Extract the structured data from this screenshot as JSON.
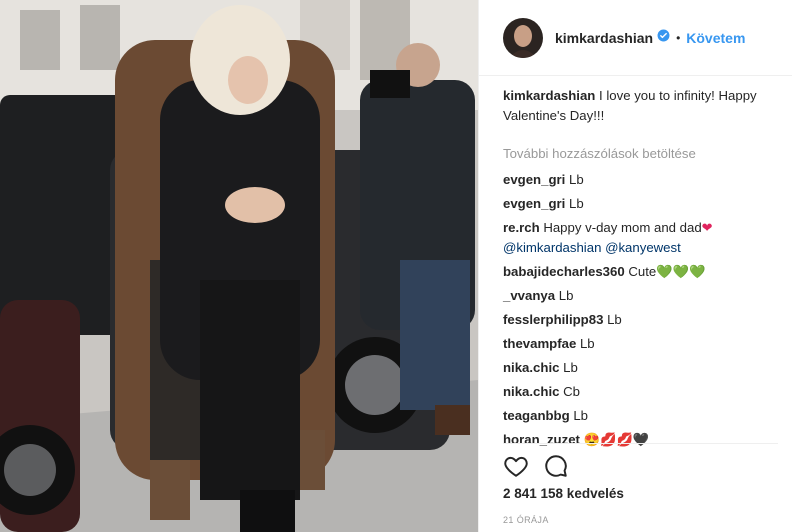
{
  "post": {
    "username": "kimkardashian",
    "follow_label": "Követem",
    "dot": "•",
    "caption_user": "kimkardashian",
    "caption_text": "I love you to infinity! Happy Valentine's Day!!!",
    "load_more": "További hozzászólások betöltése",
    "comments": [
      {
        "user": "evgen_gri",
        "text": "Lb"
      },
      {
        "user": "evgen_gri",
        "text": "Lb"
      },
      {
        "user": "re.rch",
        "text": "Happy v-day mom and dad",
        "emoji": "❤",
        "mentions": "@kimkardashian @kanyewest"
      },
      {
        "user": "babajidecharles360",
        "text": "Cute",
        "emoji": "💚💚💚"
      },
      {
        "user": "_vvanya",
        "text": "Lb"
      },
      {
        "user": "fesslerphilipp83",
        "text": "Lb"
      },
      {
        "user": "thevampfae",
        "text": "Lb"
      },
      {
        "user": "nika.chic",
        "text": "Lb"
      },
      {
        "user": "nika.chic",
        "text": "Cb"
      },
      {
        "user": "teaganbbg",
        "text": "Lb"
      },
      {
        "user": "horan_zuzet",
        "text": "",
        "emoji": "😍💋💋🖤"
      }
    ],
    "likes": "2 841 158 kedvelés",
    "time": "21 ÓRÁJA"
  },
  "icons": {
    "like": "heart-outline-icon",
    "comment": "comment-bubble-icon",
    "verified": "verified-badge-icon"
  },
  "colors": {
    "follow": "#3897f0",
    "verified": "#3897f0",
    "mention": "#003569",
    "muted": "#999999"
  }
}
